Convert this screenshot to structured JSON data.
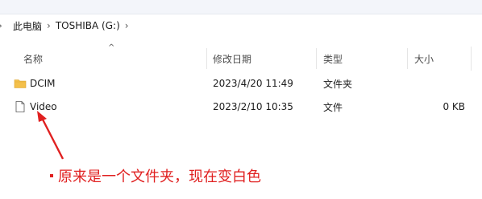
{
  "breadcrumb": {
    "items": [
      "此电脑",
      "TOSHIBA (G:)"
    ]
  },
  "columns": {
    "name": "名称",
    "modified": "修改日期",
    "type": "类型",
    "size": "大小"
  },
  "files": [
    {
      "name": "DCIM",
      "modified": "2023/4/20 11:49",
      "type": "文件夹",
      "size": "",
      "icon": "folder-icon"
    },
    {
      "name": "Video",
      "modified": "2023/2/10 10:35",
      "type": "文件",
      "size": "0 KB",
      "icon": "file-icon"
    }
  ],
  "annotation": {
    "text": "原来是一个文件夹，现在变白色",
    "color": "#e02020"
  },
  "colors": {
    "folder": "#f4c04a",
    "accent": "#e02020"
  }
}
